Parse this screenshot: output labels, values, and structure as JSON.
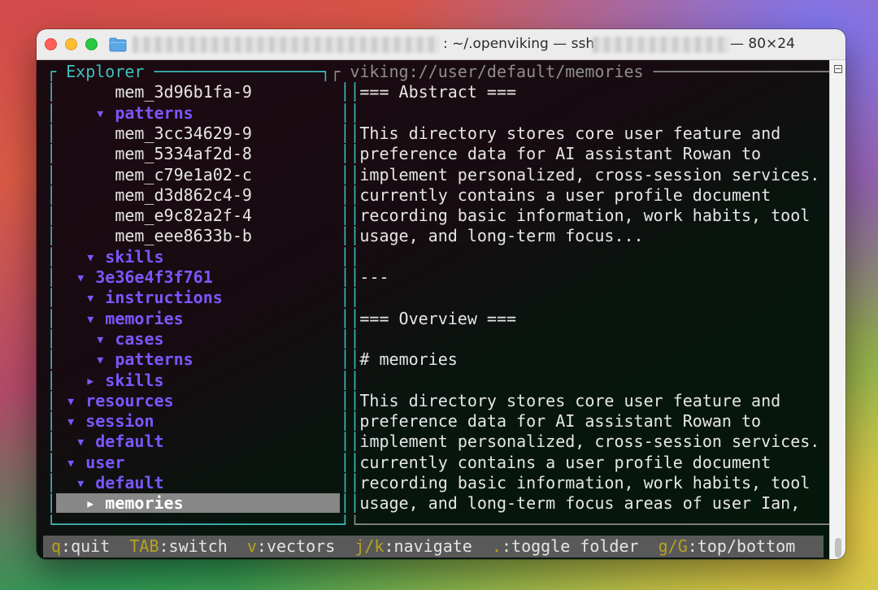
{
  "window": {
    "title_path": ": ~/.openviking — ssh",
    "title_size": "— 80×24"
  },
  "explorer": {
    "title": "Explorer",
    "tree": [
      {
        "label": "mem_3d96b1fa-9",
        "kind": "file"
      },
      {
        "label": "▾ patterns",
        "kind": "folder"
      },
      {
        "label": "mem_3cc34629-9",
        "kind": "file"
      },
      {
        "label": "mem_5334af2d-8",
        "kind": "file"
      },
      {
        "label": "mem_c79e1a02-c",
        "kind": "file"
      },
      {
        "label": "mem_d3d862c4-9",
        "kind": "file"
      },
      {
        "label": "mem_e9c82a2f-4",
        "kind": "file"
      },
      {
        "label": "mem_eee8633b-b",
        "kind": "file"
      },
      {
        "label": "▾ skills",
        "kind": "folder"
      },
      {
        "label": "▾ 3e36e4f3f761",
        "kind": "folder"
      },
      {
        "label": "▾ instructions",
        "kind": "folder"
      },
      {
        "label": "▾ memories",
        "kind": "folder"
      },
      {
        "label": "▾ cases",
        "kind": "folder"
      },
      {
        "label": "▾ patterns",
        "kind": "folder"
      },
      {
        "label": "▸ skills",
        "kind": "folder"
      },
      {
        "label": "▾ resources",
        "kind": "folder"
      },
      {
        "label": "▾ session",
        "kind": "folder"
      },
      {
        "label": "▾ default",
        "kind": "folder"
      },
      {
        "label": "▾ user",
        "kind": "folder"
      },
      {
        "label": "▾ default",
        "kind": "folder"
      },
      {
        "label": "▸ memories",
        "kind": "selected"
      }
    ]
  },
  "content": {
    "title": "viking://user/default/memories",
    "lines": [
      "=== Abstract ===",
      "",
      "This directory stores core user feature and",
      "preference data for AI assistant Rowan to",
      "implement personalized, cross-session services. It",
      "currently contains a user profile document",
      "recording basic information, work habits, tool",
      "usage, and long-term focus...",
      "",
      "---",
      "",
      "=== Overview ===",
      "",
      "# memories",
      "",
      "This directory stores core user feature and",
      "preference data for AI assistant Rowan to",
      "implement personalized, cross-session services. It",
      "currently contains a user profile document",
      "recording basic information, work habits, tool",
      "usage, and long-term focus areas of user Ian,"
    ]
  },
  "statusbar": [
    {
      "key": "q",
      "label": ":quit"
    },
    {
      "key": "TAB",
      "label": ":switch"
    },
    {
      "key": "v",
      "label": ":vectors"
    },
    {
      "key": "j/k",
      "label": ":navigate"
    },
    {
      "key": ".",
      "label": ":toggle folder"
    },
    {
      "key": "g/G",
      "label": ":top/bottom"
    }
  ],
  "colors": {
    "explorer_border": "#3fbfbf",
    "content_border": "#8e8e8e",
    "folder": "#7b57ff",
    "status_key": "#b8a21f",
    "selection": "#878787"
  }
}
